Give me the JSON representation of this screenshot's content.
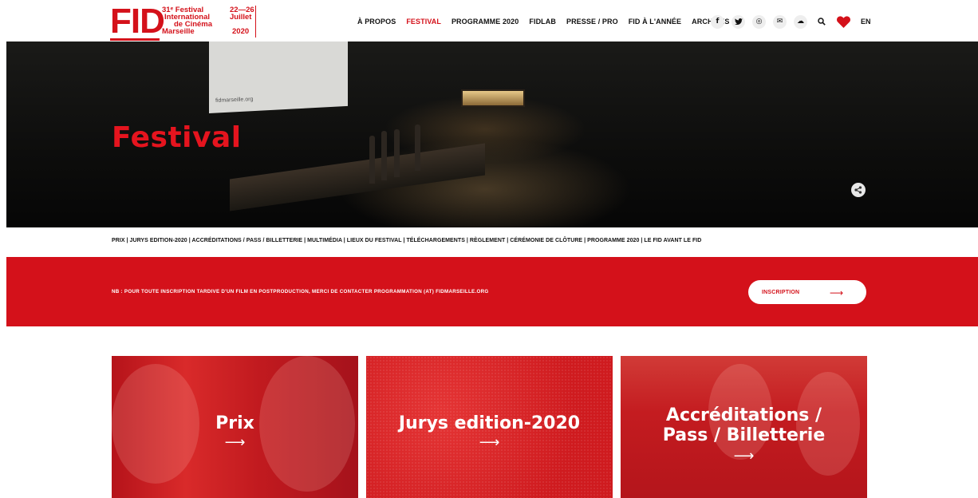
{
  "logo": {
    "name": "FID",
    "edition": "31ᵉ Festival",
    "line2": "International",
    "line3": "de Cinéma",
    "city": "Marseille",
    "dates": "22—26",
    "month": "Juillet",
    "year": "2020"
  },
  "nav": {
    "items": [
      {
        "label": "À PROPOS",
        "active": false
      },
      {
        "label": "FESTIVAL",
        "active": true
      },
      {
        "label": "PROGRAMME 2020",
        "active": false
      },
      {
        "label": "FIDLAB",
        "active": false
      },
      {
        "label": "PRESSE / PRO",
        "active": false
      },
      {
        "label": "FID À L'ANNÉE",
        "active": false
      },
      {
        "label": "ARCHIVES",
        "active": false
      }
    ],
    "social_icons": [
      "facebook-icon",
      "twitter-icon",
      "instagram-icon",
      "mail-icon",
      "cloud-icon",
      "search-icon",
      "heart-icon"
    ],
    "social_glyphs": [
      "f",
      "🐦",
      "◎",
      "✉",
      "☁",
      "⌕",
      "♥"
    ],
    "language": "EN"
  },
  "hero": {
    "title": "Festival",
    "screen_text": "fidmarseille.org",
    "share_icon": "share-icon"
  },
  "subnav": {
    "text": "PRIX | JURYS EDITION-2020 | ACCRÉDITATIONS / PASS / BILLETTERIE | MULTIMÉDIA | LIEUX DU FESTIVAL | TÉLÉCHARGEMENTS | RÈGLEMENT | CÉRÉMONIE DE CLÔTURE | PROGRAMME 2020 | LE FID AVANT LE FID"
  },
  "banner": {
    "notice": "NB : POUR TOUTE INSCRIPTION TARDIVE D'UN FILM EN POSTPRODUCTION, MERCI DE CONTACTER PROGRAMMATION (AT) FIDMARSEILLE.ORG",
    "button_label": "INSCRIPTION",
    "button_arrow": "⟶"
  },
  "cards": [
    {
      "title": "Prix",
      "arrow": "⟶"
    },
    {
      "title": "Jurys edition-2020",
      "arrow": "⟶"
    },
    {
      "title_line1": "Accréditations /",
      "title_line2": "Pass / Billetterie",
      "arrow": "⟶"
    }
  ],
  "colors": {
    "brand_red": "#d4111a",
    "hero_title_red": "#e5141e",
    "text_dark": "#111111",
    "white": "#ffffff"
  }
}
